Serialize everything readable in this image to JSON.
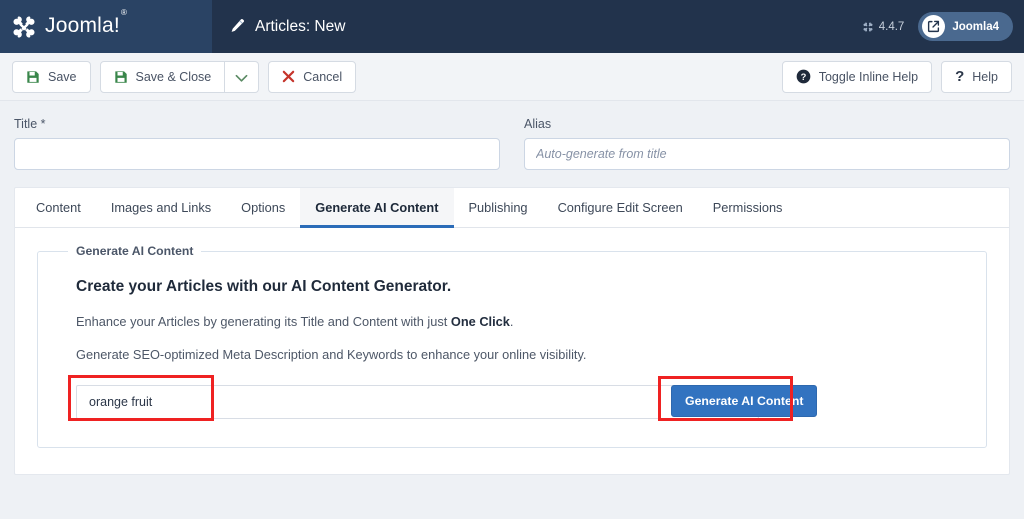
{
  "header": {
    "brand_name": "Joomla!",
    "brand_reg": "®",
    "page_title": "Articles: New",
    "version": "4.4.7",
    "site_pill": "Joomla4",
    "icons": {
      "logo": "joomla-logo-icon",
      "title": "pencil-icon",
      "external": "external-link-icon"
    }
  },
  "toolbar": {
    "save_label": "Save",
    "save_close_label": "Save & Close",
    "cancel_label": "Cancel",
    "toggle_inline_help_label": "Toggle Inline Help",
    "help_label": "Help",
    "help_glyph": "?"
  },
  "form": {
    "title_label": "Title *",
    "title_value": "",
    "title_placeholder": "",
    "alias_label": "Alias",
    "alias_value": "",
    "alias_placeholder": "Auto-generate from title"
  },
  "tabs": [
    {
      "label": "Content",
      "active": false
    },
    {
      "label": "Images and Links",
      "active": false
    },
    {
      "label": "Options",
      "active": false
    },
    {
      "label": "Generate AI Content",
      "active": true
    },
    {
      "label": "Publishing",
      "active": false
    },
    {
      "label": "Configure Edit Screen",
      "active": false
    },
    {
      "label": "Permissions",
      "active": false
    }
  ],
  "panel": {
    "legend": "Generate AI Content",
    "heading": "Create your Articles with our AI Content Generator.",
    "para1_before": "Enhance your Articles by generating its Title and Content with just ",
    "para1_bold": "One Click",
    "para1_after": ".",
    "para2": "Generate SEO-optimized Meta Description and Keywords to enhance your online visibility.",
    "prompt_value": "orange fruit",
    "prompt_placeholder": "",
    "generate_button": "Generate AI Content"
  },
  "colors": {
    "brand_navy": "#2a4364",
    "title_navy": "#22334c",
    "accent_blue": "#3273c0",
    "tab_underline": "#2b6cb8",
    "annotation_red": "#ef2222",
    "save_green": "#39864a",
    "cancel_red": "#c5342b",
    "page_bg": "#eef1f5"
  }
}
